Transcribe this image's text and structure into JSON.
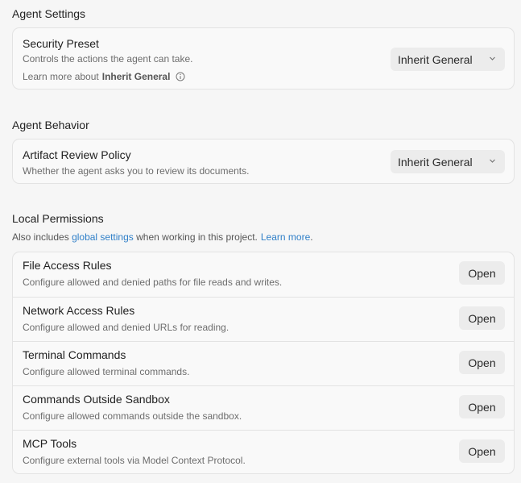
{
  "agent_settings": {
    "title": "Agent Settings",
    "security_preset": {
      "label": "Security Preset",
      "description": "Controls the actions the agent can take.",
      "learn_prefix": "Learn more about",
      "learn_target": "Inherit General",
      "selected": "Inherit General"
    }
  },
  "agent_behavior": {
    "title": "Agent Behavior",
    "artifact_review": {
      "label": "Artifact Review Policy",
      "description": "Whether the agent asks you to review its documents.",
      "selected": "Inherit General"
    }
  },
  "local_permissions": {
    "title": "Local Permissions",
    "subtext_prefix": "Also includes",
    "global_link": "global settings",
    "subtext_middle": "when working in this project.",
    "learn_link": "Learn more",
    "subtext_suffix": ".",
    "open_label": "Open",
    "items": [
      {
        "label": "File Access Rules",
        "description": "Configure allowed and denied paths for file reads and writes."
      },
      {
        "label": "Network Access Rules",
        "description": "Configure allowed and denied URLs for reading."
      },
      {
        "label": "Terminal Commands",
        "description": "Configure allowed terminal commands."
      },
      {
        "label": "Commands Outside Sandbox",
        "description": "Configure allowed commands outside the sandbox."
      },
      {
        "label": "MCP Tools",
        "description": "Configure external tools via Model Context Protocol."
      }
    ]
  },
  "colors": {
    "background": "#f6f6f6",
    "card": "#f9f9f9",
    "button": "#ececec",
    "link": "#2f7fc8"
  },
  "icons": {
    "info": "info-icon",
    "dropdown": "chevron-down-icon"
  }
}
